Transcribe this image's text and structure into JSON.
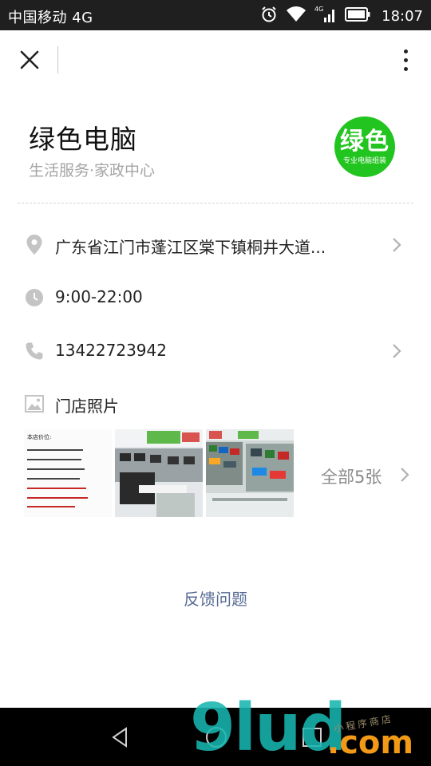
{
  "status_bar": {
    "carrier": "中国移动 4G",
    "network_badge": "4G",
    "time": "18:07",
    "icons": [
      "alarm-icon",
      "wifi-icon",
      "signal-icon",
      "battery-icon"
    ]
  },
  "top_bar": {
    "close_icon": "close-icon",
    "more_icon": "more-vertical-icon"
  },
  "shop": {
    "name": "绿色电脑",
    "category": "生活服务·家政中心",
    "logo": {
      "main_text": "绿色",
      "sub_text": "专业电脑组装"
    }
  },
  "details": {
    "address": "广东省江门市蓬江区棠下镇桐井大道...",
    "hours": "9:00-22:00",
    "phone": "13422723942",
    "photos_label": "门店照片"
  },
  "photos": {
    "count_label": "全部5张",
    "items": [
      {
        "kind": "price-list",
        "lines": [
          "本店价位:",
          "",
          "",
          "",
          "",
          "",
          "",
          ""
        ]
      },
      {
        "kind": "store-interior"
      },
      {
        "kind": "store-shelves"
      }
    ]
  },
  "feedback_label": "反馈问题",
  "nav_bar": {
    "icons": [
      "back-icon",
      "home-icon",
      "recent-apps-icon"
    ]
  },
  "watermark": {
    "brand": "9lud",
    "suffix": ".com",
    "tagline": "小程序商店"
  },
  "colors": {
    "status_bar_bg": "#1f1f1f",
    "logo_green": "#22c41f",
    "link_blue": "#576b95",
    "secondary_text": "#a4a4a4",
    "icon_gray": "#c4c4c4",
    "watermark_teal": "#18b6b0",
    "watermark_orange": "#f29a18"
  }
}
